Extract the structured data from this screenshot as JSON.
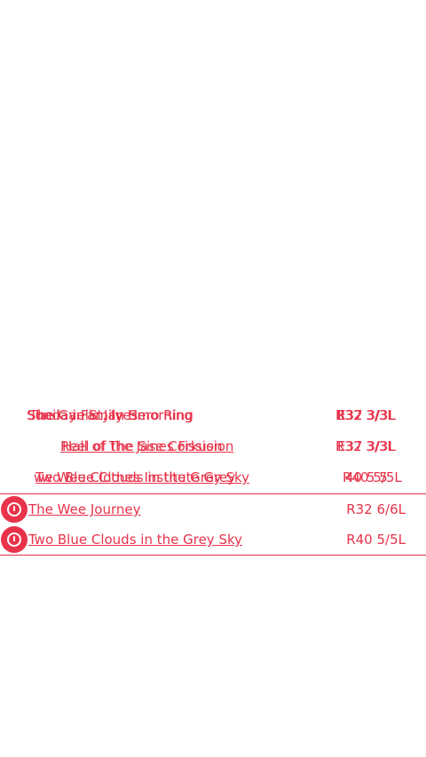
{
  "accent_color": "#e8334a",
  "overlapping_rows": [
    {
      "layers": [
        {
          "title": "Sheila in St. Ives",
          "meta": "R32 3/3L"
        },
        {
          "title": "Sunday Family Hero Ring",
          "meta": "E37 3/3L"
        },
        {
          "title": "The Gaelic Jan Smorning",
          "meta": "R32 3/3L"
        }
      ]
    },
    {
      "layers": [
        {
          "title": "Reel of the Jase Corkusion",
          "meta": "R32 3/3L"
        },
        {
          "title": "Hall of The Sines Fission",
          "meta": "E37 3/3L"
        }
      ]
    },
    {
      "layers": [
        {
          "title": "Two Blue Clouds in the Grey Sky",
          "meta": "R40 5/5L"
        },
        {
          "title": "we Wee Clothes Institute Grey",
          "meta": "40 5 5"
        }
      ]
    }
  ],
  "dances": [
    {
      "icon": "info-icon",
      "title": "The Wee Journey",
      "meta": "R32 6/6L"
    },
    {
      "icon": "info-icon",
      "title": "Two Blue Clouds in the Grey Sky",
      "meta": "R40 5/5L"
    }
  ]
}
